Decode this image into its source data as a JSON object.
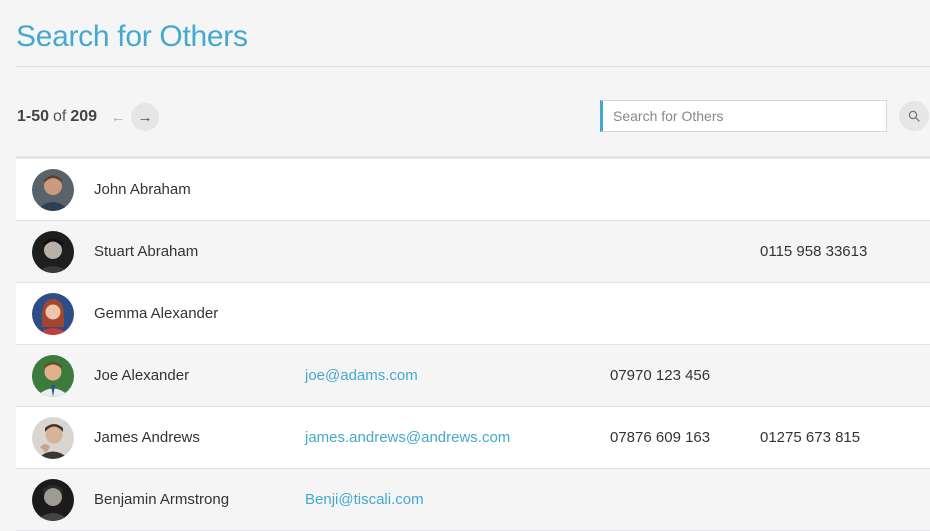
{
  "page": {
    "title": "Search for Others"
  },
  "pager": {
    "range": "1-50",
    "of": "of",
    "total": "209"
  },
  "search": {
    "placeholder": "Search for Others",
    "value": ""
  },
  "icons": {
    "prev": "arrow-left-icon",
    "next": "arrow-right-icon",
    "search": "magnifier-icon"
  },
  "colors": {
    "accent": "#45a9cf",
    "background": "#f5f5f6"
  },
  "people": [
    {
      "name": "John Abraham",
      "email": "",
      "mobile": "",
      "phone": ""
    },
    {
      "name": "Stuart Abraham",
      "email": "",
      "mobile": "",
      "phone": "0115 958 33613"
    },
    {
      "name": "Gemma Alexander",
      "email": "",
      "mobile": "",
      "phone": ""
    },
    {
      "name": "Joe Alexander",
      "email": "joe@adams.com",
      "mobile": "07970 123 456",
      "phone": ""
    },
    {
      "name": "James Andrews",
      "email": "james.andrews@andrews.com",
      "mobile": "07876 609 163",
      "phone": "01275 673 815"
    },
    {
      "name": "Benjamin Armstrong",
      "email": "Benji@tiscali.com",
      "mobile": "",
      "phone": ""
    }
  ]
}
